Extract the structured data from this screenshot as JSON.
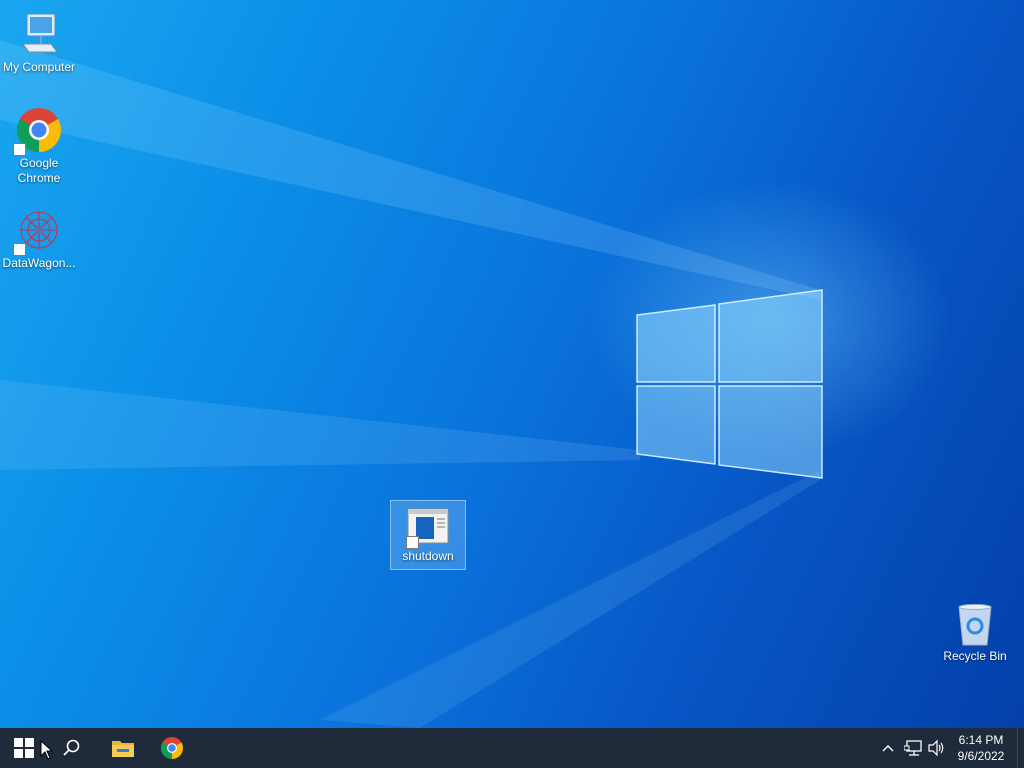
{
  "desktop": {
    "icons": [
      {
        "label": "My Computer",
        "icon": "computer-icon"
      },
      {
        "label": "Google\nChrome",
        "icon": "chrome-icon"
      },
      {
        "label": "DataWagon...",
        "icon": "datawagon-icon"
      },
      {
        "label": "shutdown",
        "icon": "shutdown-shortcut-icon",
        "selected": true
      },
      {
        "label": "Recycle Bin",
        "icon": "recycle-bin-icon"
      }
    ]
  },
  "taskbar": {
    "start_icon": "windows-logo-icon",
    "search_icon": "search-icon",
    "pinned": [
      {
        "name": "File Explorer",
        "icon": "folder-icon"
      },
      {
        "name": "Google Chrome",
        "icon": "chrome-icon"
      }
    ],
    "tray": {
      "chevron_icon": "chevron-up-icon",
      "network_icon": "network-icon",
      "volume_icon": "volume-icon",
      "time": "6:14 PM",
      "date": "9/6/2022"
    }
  },
  "colors": {
    "taskbar": "#1f2a3a",
    "desktop_light": "#1aa7f0",
    "desktop_dark": "#0440aa"
  }
}
